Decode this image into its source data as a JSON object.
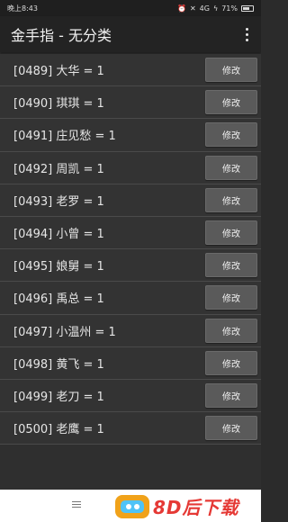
{
  "statusbar": {
    "time": "晚上8:43",
    "network": "4G",
    "battery": "71%",
    "battery_level": 0.71
  },
  "appbar": {
    "title": "金手指 - 无分类"
  },
  "items": [
    {
      "label": "[0489] 大华 = 1",
      "button": "修改"
    },
    {
      "label": "[0490] 琪琪 = 1",
      "button": "修改"
    },
    {
      "label": "[0491] 庄见愁 = 1",
      "button": "修改"
    },
    {
      "label": "[0492] 周凯 = 1",
      "button": "修改"
    },
    {
      "label": "[0493] 老罗 = 1",
      "button": "修改"
    },
    {
      "label": "[0494] 小曾 = 1",
      "button": "修改"
    },
    {
      "label": "[0495] 娘舅 = 1",
      "button": "修改"
    },
    {
      "label": "[0496] 禹总 = 1",
      "button": "修改"
    },
    {
      "label": "[0497] 小温州 = 1",
      "button": "修改"
    },
    {
      "label": "[0498] 黄飞 = 1",
      "button": "修改"
    },
    {
      "label": "[0499] 老刀 = 1",
      "button": "修改"
    },
    {
      "label": "[0500] 老鹰 = 1",
      "button": "修改"
    }
  ],
  "watermark": {
    "text": "8D后下载"
  }
}
